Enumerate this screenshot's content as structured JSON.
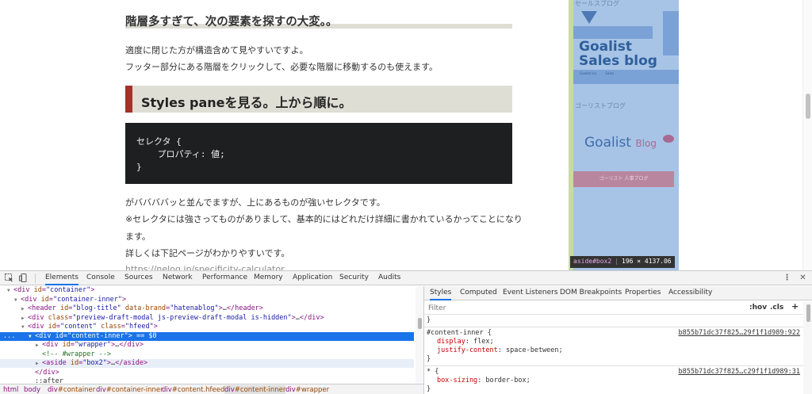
{
  "article": {
    "heading3": "階層多すぎて、次の要素を探すの大変。。",
    "para1": "適度に閉じた方が構造含めて見やすいですよ。",
    "para2": "フッター部分にある階層をクリックして、必要な階層に移動するのも使えます。",
    "heading2": "Styles paneを見る。上から順に。",
    "code": [
      "セレクタ {",
      "    プロパティ: 値;",
      "}"
    ],
    "para3": "がババババッと並んでますが、上にあるものが強いセレクタです。",
    "para4a": "※セレクタには強さってものがありまして、基本的にはどれだけ詳細に書かれているかってことになり",
    "para4b": "ます。",
    "para5": "詳しくは下記ページがわかりやすいです。",
    "link": "https://nelog.jp/specificity-calculator"
  },
  "sidebar": {
    "top_label": "セールスブログ",
    "sales_title_1": "Goalist",
    "sales_title_2": "Sales blog",
    "mini_1": "Goalist Inc.",
    "mini_2": "Sales",
    "label2": "ゴーリストブログ",
    "logo_main": "Goalist",
    "logo_blog": "Blog",
    "pink_text": "ゴーリスト 人事ブログ"
  },
  "tooltip": {
    "tag": "aside#box2",
    "size": "196 × 4137.06"
  },
  "devtools": {
    "tabs": [
      "Elements",
      "Console",
      "Sources",
      "Network",
      "Performance",
      "Memory",
      "Application",
      "Security",
      "Audits"
    ],
    "active_tab": "Elements",
    "elements": [
      {
        "indent": 1,
        "arrow": "▼",
        "html": "<span>&lt;div </span><span class=\"attr\">id</span>=<span class=\"val\">\"container\"</span>&gt;"
      },
      {
        "indent": 2,
        "arrow": "▼",
        "html": "&lt;div <span class=\"attr\">id</span>=<span class=\"val\">\"container-inner\"</span>&gt;"
      },
      {
        "indent": 3,
        "arrow": "▶",
        "html": "&lt;header <span class=\"attr\">id</span>=<span class=\"val\">\"blog-title\"</span> <span class=\"attr\">data-brand</span>=<span class=\"val\">\"hatenablog\"</span>&gt;<span class=\"txt\">…</span>&lt;/header&gt;"
      },
      {
        "indent": 3,
        "arrow": "▶",
        "html": "&lt;div <span class=\"attr\">class</span>=<span class=\"val\">\"preview-draft-modal js-preview-draft-modal is-hidden\"</span>&gt;<span class=\"txt\">…</span>&lt;/div&gt;"
      },
      {
        "indent": 3,
        "arrow": "▼",
        "html": "&lt;div <span class=\"attr\">id</span>=<span class=\"val\">\"content\"</span> <span class=\"attr\">class</span>=<span class=\"val\">\"hfeed\"</span>&gt;"
      },
      {
        "indent": 4,
        "arrow": "▼",
        "html": "&lt;div <span class=\"attr\">id</span>=<span class=\"val\">\"content-inner\"</span>&gt; <span class=\"txt\">== $0</span>",
        "selected": true
      },
      {
        "indent": 5,
        "arrow": "▶",
        "html": "&lt;div <span class=\"attr\">id</span>=<span class=\"val\">\"wrapper\"</span>&gt;<span class=\"txt\">…</span>&lt;/div&gt;"
      },
      {
        "indent": 5,
        "arrow": "",
        "html": "<span class=\"cmt\">&lt;!-- #wrapper --&gt;</span>"
      },
      {
        "indent": 5,
        "arrow": "▶",
        "html": "&lt;aside <span class=\"attr\">id</span>=<span class=\"val\">\"box2\"</span>&gt;<span class=\"txt\">…</span>&lt;/aside&gt;",
        "hover": true
      },
      {
        "indent": 4,
        "arrow": "",
        "html": "&lt;/div&gt;"
      },
      {
        "indent": 4,
        "arrow": "",
        "html": "<span class=\"txt\">::after</span>"
      }
    ],
    "selected_dots": "...",
    "breadcrumbs": [
      {
        "tag": "html",
        "cls": ""
      },
      {
        "tag": "body",
        "cls": ""
      },
      {
        "tag": "div",
        "cls": "#container"
      },
      {
        "tag": "div",
        "cls": "#container-inner"
      },
      {
        "tag": "div",
        "cls": "#content.hfeed"
      },
      {
        "tag": "div",
        "cls": "#content-inner",
        "active": true
      },
      {
        "tag": "div",
        "cls": "#wrapper"
      }
    ],
    "styles_tabs": [
      "Styles",
      "Computed",
      "Event Listeners",
      "DOM Breakpoints",
      "Properties",
      "Accessibility"
    ],
    "styles_active": "Styles",
    "filter_placeholder": "Filter",
    "hov_label": ":hov",
    "cls_label": ".cls",
    "plus_label": "+",
    "rules": {
      "prev_close": "}",
      "rule1_selector": "#content-inner {",
      "rule1_src": "b855b71dc37f825…29f1f1d989:922",
      "rule1_p1_name": "display",
      "rule1_p1_val": ": flex;",
      "rule1_p2_name": "justify-content",
      "rule1_p2_val": ": space-between;",
      "rule1_close": "}",
      "rule2_selector": "* {",
      "rule2_src": "b855b71dc37f825…c29f1f1d989:31",
      "rule2_p1_name": "box-sizing",
      "rule2_p1_val": ": border-box;",
      "rule2_close": "}"
    }
  }
}
